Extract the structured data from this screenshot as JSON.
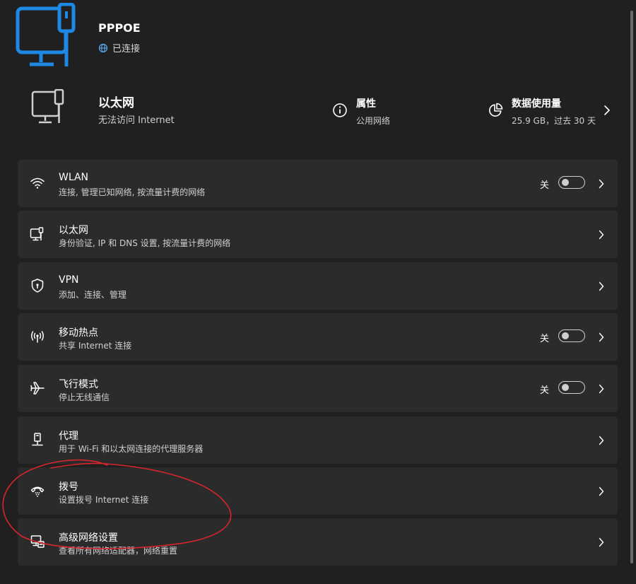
{
  "hero": {
    "title": "PPPOE",
    "status": "已连接",
    "icon": "ethernet-computer-icon",
    "accent": "#1e88e5"
  },
  "ethernet": {
    "title": "以太网",
    "subtitle": "无法访问 Internet",
    "properties": {
      "title": "属性",
      "subtitle": "公用网络",
      "icon": "info-icon"
    },
    "usage": {
      "title": "数据使用量",
      "subtitle": "25.9 GB，过去 30 天",
      "icon": "pie-chart-icon"
    }
  },
  "items": [
    {
      "title": "WLAN",
      "subtitle": "连接, 管理已知网络, 按流量计费的网络",
      "icon": "wifi-icon",
      "toggle_state": "关"
    },
    {
      "title": "以太网",
      "subtitle": "身份验证, IP 和 DNS 设置, 按流量计费的网络",
      "icon": "ethernet-icon"
    },
    {
      "title": "VPN",
      "subtitle": "添加、连接、管理",
      "icon": "shield-icon"
    },
    {
      "title": "移动热点",
      "subtitle": "共享 Internet 连接",
      "icon": "hotspot-icon",
      "toggle_state": "关"
    },
    {
      "title": "飞行模式",
      "subtitle": "停止无线通信",
      "icon": "airplane-icon",
      "toggle_state": "关"
    },
    {
      "title": "代理",
      "subtitle": "用于 Wi-Fi 和以太网连接的代理服务器",
      "icon": "proxy-icon"
    },
    {
      "title": "拨号",
      "subtitle": "设置拨号 Internet 连接",
      "icon": "dialup-icon"
    },
    {
      "title": "高级网络设置",
      "subtitle": "查看所有网络适配器，网络重置",
      "icon": "network-adapter-icon"
    }
  ],
  "annotation_color": "#d9262e"
}
